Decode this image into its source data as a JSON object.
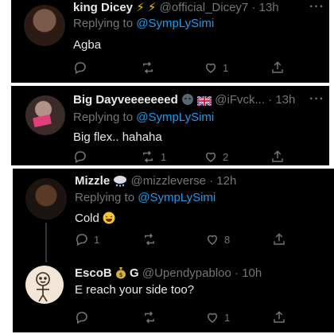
{
  "tweets": [
    {
      "name": "king Dicey",
      "badges": "⚡ ⚡",
      "handle": "@official_Dicey7",
      "time": "· 13h",
      "replying_prefix": "Replying to",
      "replying_to": "@SympLySimi",
      "text": "Agba",
      "replies": "",
      "retweets": "",
      "likes": "1"
    },
    {
      "name": "Big Dayveeeeeeed",
      "handle": "@iFvck...",
      "time": "· 13h",
      "replying_prefix": "Replying to",
      "replying_to": "@SympLySimi",
      "text": "Big flex.. hahaha",
      "replies": "",
      "retweets": "1",
      "likes": "2"
    },
    {
      "name": "Mizzle",
      "handle": "@mizzleverse",
      "time": "· 12h",
      "replying_prefix": "Replying to",
      "replying_to": "@SympLySimi",
      "text": "Cold",
      "replies": "1",
      "retweets": "",
      "likes": "8"
    },
    {
      "name_part1": "EscoB",
      "name_part2": "G",
      "handle": "@Upendypabloo",
      "time": "· 10h",
      "text": "E reach your side too?",
      "replies": "",
      "retweets": "",
      "likes": "1"
    }
  ],
  "more_label": "···",
  "colors": {
    "background": "#000000",
    "text": "#e7e9ea",
    "muted": "#71767b",
    "link": "#1d9bf0"
  }
}
